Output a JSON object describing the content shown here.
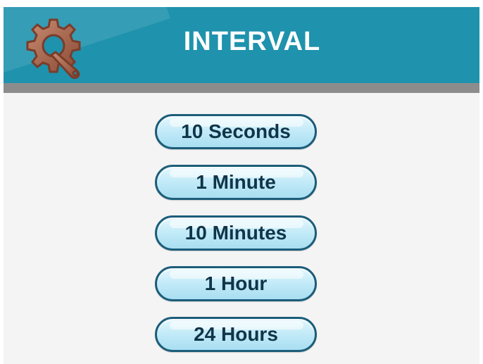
{
  "header": {
    "title": "INTERVAL",
    "icon": "gear-wrench-icon",
    "background_color": "#1f92ad",
    "divider_color": "#8c8c8c",
    "title_color": "#ffffff"
  },
  "options": [
    {
      "label": "10 Seconds"
    },
    {
      "label": "1 Minute"
    },
    {
      "label": "10 Minutes"
    },
    {
      "label": "1 Hour"
    },
    {
      "label": "24 Hours"
    }
  ],
  "style": {
    "button_border_color": "#1c5d7a",
    "button_text_color": "#10354a",
    "screen_background": "#f4f4f4"
  }
}
